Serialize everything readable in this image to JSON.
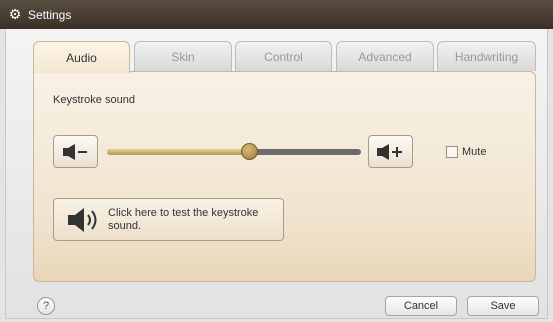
{
  "window": {
    "title": "Settings",
    "icon": "gear-icon"
  },
  "tabs": [
    {
      "label": "Audio",
      "active": true
    },
    {
      "label": "Skin",
      "active": false
    },
    {
      "label": "Control",
      "active": false
    },
    {
      "label": "Advanced",
      "active": false
    },
    {
      "label": "Handwriting",
      "active": false
    }
  ],
  "audio": {
    "section_label": "Keystroke sound",
    "volume_level": 0.56,
    "volume_down_icon": "speaker-minus-icon",
    "volume_up_icon": "speaker-plus-icon",
    "mute_label": "Mute",
    "mute_checked": false,
    "test_button_label": "Click here to test the keystroke sound.",
    "test_button_icon": "speaker-icon"
  },
  "footer": {
    "help_label": "?",
    "cancel_label": "Cancel",
    "save_label": "Save"
  },
  "colors": {
    "titlebar": "#4a3f34",
    "panel": "#f3e7d2",
    "slider_fill": "#c8ad67",
    "slider_track": "#6b6b6b"
  }
}
